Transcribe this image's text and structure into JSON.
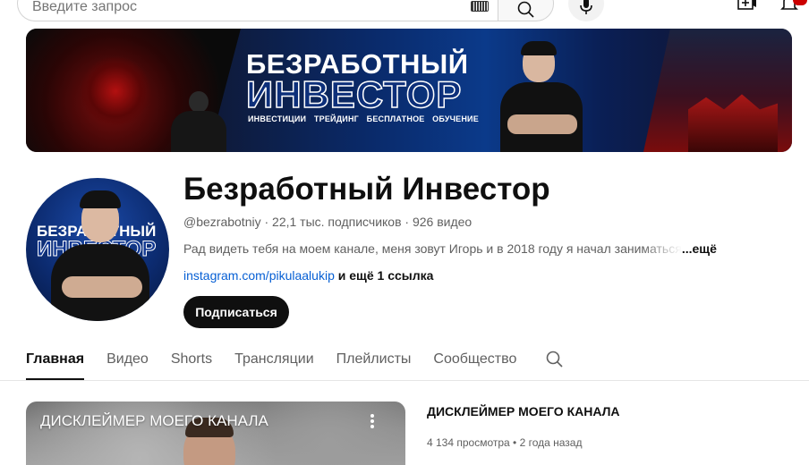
{
  "header": {
    "search_placeholder": "Введите запрос",
    "icons": [
      "keyboard-icon",
      "search-icon",
      "mic-icon",
      "create-icon",
      "bell-icon"
    ]
  },
  "banner": {
    "title_line1": "БЕЗРАБОТНЫЙ",
    "title_line2": "ИНВЕСТОР",
    "tags": "ИНВЕСТИЦИИ ТРЕЙДИНГ БЕСПЛАТНОЕ ОБУЧЕНИЕ"
  },
  "avatar": {
    "line1": "БЕЗРАБОТНЫЙ",
    "line2": "ИНВЕСТОР"
  },
  "channel": {
    "name": "Безработный Инвестор",
    "meta": "@bezrabotniy · 22,1 тыс. подписчиков · 926 видео",
    "description": "Рад видеть тебя на моем канале, меня зовут Игорь и в 2018 году я начал заниматься",
    "description_more": "...ещё",
    "link_main": "instagram.com/pikulaalukip",
    "link_more": " и ещё 1 ссылка",
    "subscribe_label": "Подписаться"
  },
  "tabs": [
    {
      "label": "Главная",
      "active": true
    },
    {
      "label": "Видео",
      "active": false
    },
    {
      "label": "Shorts",
      "active": false
    },
    {
      "label": "Трансляции",
      "active": false
    },
    {
      "label": "Плейлисты",
      "active": false
    },
    {
      "label": "Сообщество",
      "active": false
    }
  ],
  "featured_video": {
    "overlay_title": "ДИСКЛЕЙМЕР МОЕГО КАНАЛА",
    "title": "ДИСКЛЕЙМЕР МОЕГО КАНАЛА",
    "meta": "4 134 просмотра • 2 года назад"
  },
  "colors": {
    "link": "#065fd4",
    "subscribe_bg": "#0f0f0f",
    "notification_badge": "#cc0000"
  }
}
